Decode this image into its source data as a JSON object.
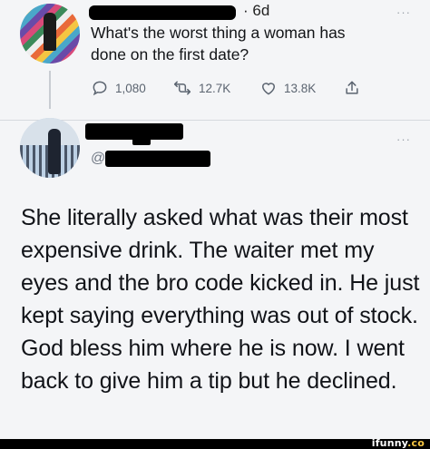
{
  "tweet": {
    "time": "· 6d",
    "more": "···",
    "question": "What's the worst thing a woman has done on the first date?",
    "stats": {
      "replies": "1,080",
      "retweets": "12.7K",
      "likes": "13.8K"
    }
  },
  "reply": {
    "more": "···",
    "handle_prefix": "@",
    "text": "She literally asked what was their most expensive drink. The waiter met my eyes and the bro code kicked in. He just kept saying everything was out of stock. God bless him where he is now. I went back to give him a tip but he declined."
  },
  "watermark": {
    "site": "ifunny",
    "suffix": ".co"
  }
}
